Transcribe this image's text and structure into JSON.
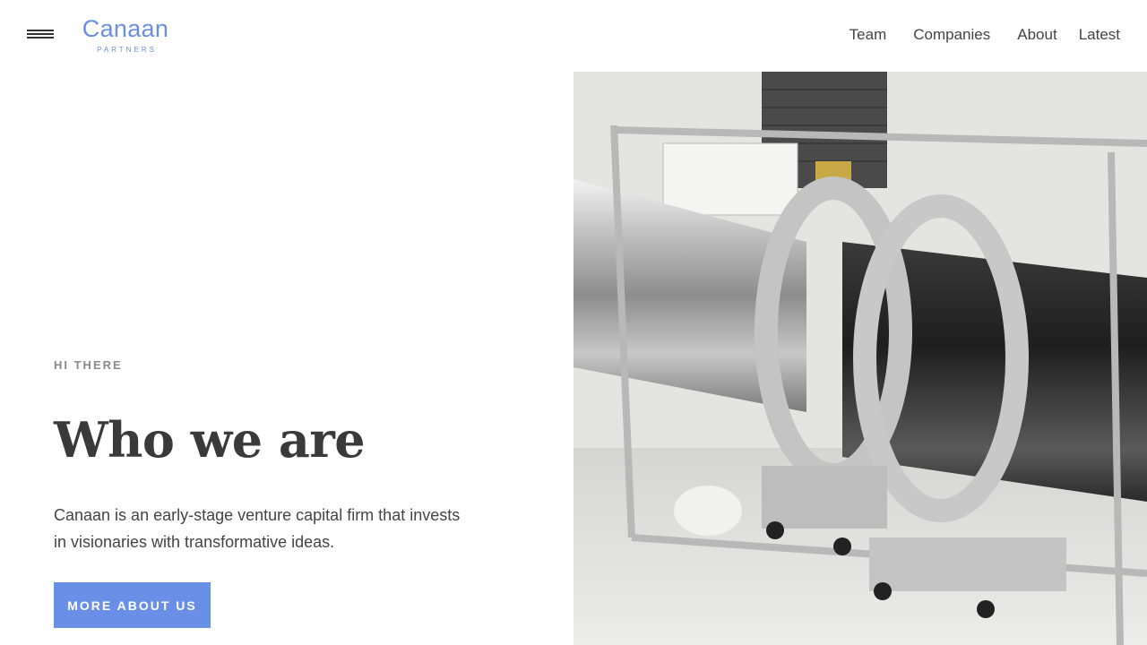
{
  "header": {
    "logo_main": "Canaan",
    "logo_sub": "PARTNERS",
    "nav": [
      {
        "label": "Team"
      },
      {
        "label": "Companies"
      },
      {
        "label": "About"
      },
      {
        "label": "Latest"
      }
    ],
    "menu_icon": "hamburger-menu-icon"
  },
  "hero": {
    "eyebrow": "HI THERE",
    "title": "Who we are",
    "description": "Canaan is an early-stage venture capital firm that invests in visionaries with transformative ideas.",
    "cta_label": "MORE ABOUT US",
    "image_subject": "rocket-body-in-assembly-fixture"
  },
  "colors": {
    "brand_blue": "#6a8fde",
    "cta_blue": "#6a8fe6",
    "text_dark": "#3a3a3a",
    "eyebrow_gray": "#8a8a8a"
  }
}
